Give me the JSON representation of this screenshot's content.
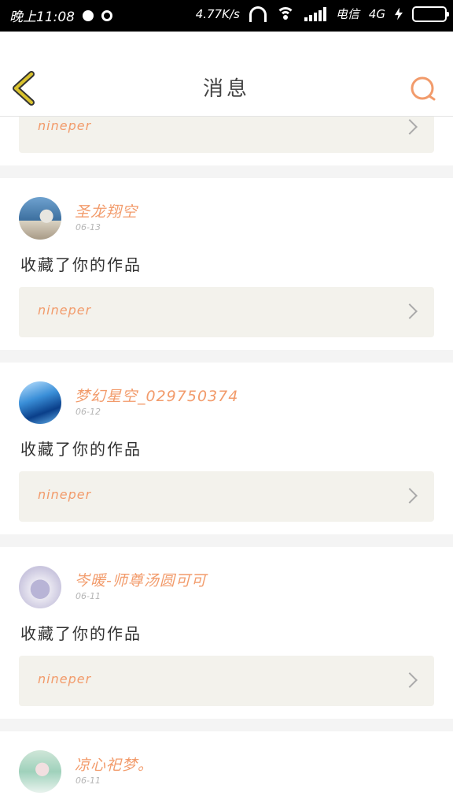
{
  "status_bar": {
    "time": "晚上11:08",
    "net_speed": "4.77K/s",
    "carrier": "电信",
    "network": "4G"
  },
  "header": {
    "title": "消息",
    "back_icon": "chevron-left-icon",
    "search_icon": "search-icon",
    "accent_color": "#f29b6b",
    "back_color": "#d9c22e"
  },
  "feed": {
    "partial_card": {
      "work_title": "nineper"
    },
    "messages": [
      {
        "user": "圣龙翔空",
        "date": "06-13",
        "text": "收藏了你的作品",
        "work_title": "nineper"
      },
      {
        "user": "梦幻星空_029750374",
        "date": "06-12",
        "text": "收藏了你的作品",
        "work_title": "nineper"
      },
      {
        "user": "岑暖-师尊汤圆可可",
        "date": "06-11",
        "text": "收藏了你的作品",
        "work_title": "nineper"
      }
    ],
    "last_card": {
      "user": "凉心祀梦。",
      "date": "06-11"
    }
  }
}
